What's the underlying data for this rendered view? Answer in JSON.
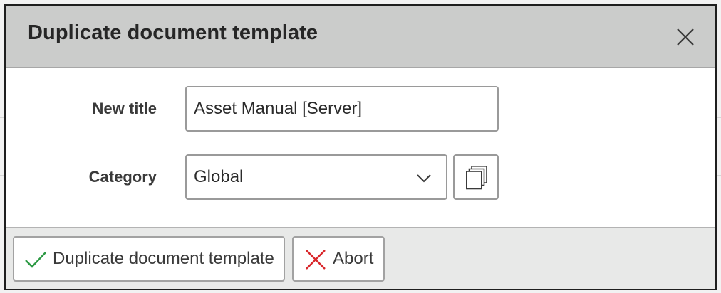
{
  "dialog": {
    "title": "Duplicate document template",
    "close_icon": "close-icon"
  },
  "form": {
    "title_label": "New title",
    "title_value": "Asset Manual [Server]",
    "category_label": "Category",
    "category_value": "Global",
    "category_chevron_icon": "chevron-down-icon",
    "copy_icon": "copy-icon"
  },
  "footer": {
    "confirm_label": "Duplicate document template",
    "confirm_icon": "check-icon",
    "abort_label": "Abort",
    "abort_icon": "x-icon"
  },
  "colors": {
    "header_bg": "#cbcccb",
    "footer_bg": "#e8e9e8",
    "check_green": "#2e9a45",
    "abort_red": "#d9262a"
  }
}
